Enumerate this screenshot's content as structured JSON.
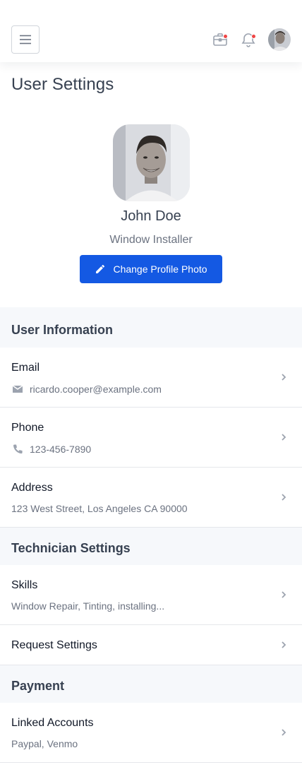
{
  "page": {
    "title": "User Settings"
  },
  "topbar": {
    "menu_icon": "hamburger-menu-icon",
    "briefcase_icon": "briefcase-icon",
    "bell_icon": "bell-icon",
    "has_notifications": true,
    "notify_color": "#ef4444"
  },
  "profile": {
    "name": "John Doe",
    "role": "Window Installer",
    "change_photo_label": "Change Profile Photo",
    "change_photo_icon": "pencil-icon",
    "accent_color": "#1459e3"
  },
  "sections": {
    "user_information": {
      "title": "User Information",
      "email": {
        "label": "Email",
        "value": "ricardo.cooper@example.com",
        "icon": "envelope-icon"
      },
      "phone": {
        "label": "Phone",
        "value": "123-456-7890",
        "icon": "phone-icon"
      },
      "address": {
        "label": "Address",
        "value": "123 West Street, Los Angeles CA 90000"
      }
    },
    "technician_settings": {
      "title": "Technician Settings",
      "skills": {
        "label": "Skills",
        "value": "Window Repair, Tinting, installing..."
      },
      "request_settings": {
        "label": "Request Settings"
      }
    },
    "payment": {
      "title": "Payment",
      "linked_accounts": {
        "label": "Linked Accounts",
        "value": "Paypal, Venmo"
      }
    }
  }
}
